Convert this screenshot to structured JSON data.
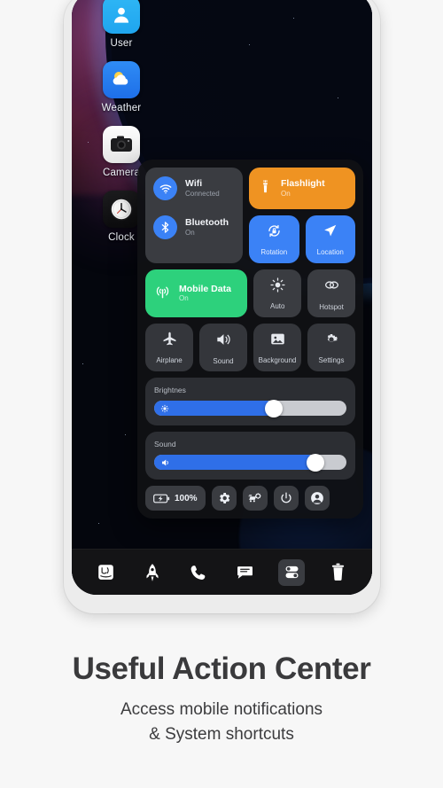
{
  "caption": {
    "headline": "Useful Action Center",
    "subtitle_line1": "Access mobile notifications",
    "subtitle_line2": "& System shortcuts"
  },
  "home_screen": {
    "apps": [
      {
        "label": "User",
        "icon": "user-icon"
      },
      {
        "label": "Weather",
        "icon": "weather-icon"
      },
      {
        "label": "Camera",
        "icon": "camera-icon"
      },
      {
        "label": "Clock",
        "icon": "clock-icon"
      }
    ]
  },
  "control_center": {
    "connectivity": [
      {
        "label": "Wifi",
        "status": "Connected",
        "icon": "wifi-icon",
        "active": true
      },
      {
        "label": "Bluetooth",
        "status": "On",
        "icon": "bluetooth-icon",
        "active": true
      }
    ],
    "flashlight": {
      "label": "Flashlight",
      "status": "On",
      "icon": "flashlight-icon",
      "color": "#ef9322"
    },
    "mobile_data": {
      "label": "Mobile Data",
      "status": "On",
      "icon": "mobile-data-icon",
      "color": "#2dd17c"
    },
    "tiles": [
      {
        "label": "Rotation",
        "icon": "rotation-lock-icon",
        "active": true,
        "color": "#3b82f6"
      },
      {
        "label": "Location",
        "icon": "location-arrow-icon",
        "active": true,
        "color": "#3b82f6"
      },
      {
        "label": "Auto",
        "icon": "brightness-auto-icon",
        "active": false
      },
      {
        "label": "Hotspot",
        "icon": "hotspot-icon",
        "active": false
      },
      {
        "label": "Airplane",
        "icon": "airplane-icon",
        "active": false
      },
      {
        "label": "Sound",
        "icon": "speaker-icon",
        "active": false
      },
      {
        "label": "Background",
        "icon": "image-icon",
        "active": false
      },
      {
        "label": "Settings",
        "icon": "gear-icon",
        "active": false
      }
    ],
    "sliders": [
      {
        "label": "Brightnes",
        "icon": "brightness-icon",
        "value": 62
      },
      {
        "label": "Sound",
        "icon": "volume-icon",
        "value": 84
      }
    ],
    "quick_actions": [
      {
        "label": "100%",
        "icon": "battery-charging-icon",
        "type": "battery"
      },
      {
        "label": "",
        "icon": "gear-icon",
        "type": "button"
      },
      {
        "label": "",
        "icon": "cleaner-boost-icon",
        "type": "button"
      },
      {
        "label": "",
        "icon": "power-icon",
        "type": "button"
      },
      {
        "label": "",
        "icon": "account-icon",
        "type": "button"
      }
    ]
  },
  "dock": {
    "items": [
      {
        "icon": "finder-icon",
        "active": false
      },
      {
        "icon": "rocket-launcher-icon",
        "active": false
      },
      {
        "icon": "phone-icon",
        "active": false
      },
      {
        "icon": "messages-icon",
        "active": false
      },
      {
        "icon": "control-center-icon",
        "active": true
      },
      {
        "icon": "trash-icon",
        "active": false
      }
    ]
  },
  "colors": {
    "accent_blue": "#3b82f6",
    "accent_orange": "#ef9322",
    "accent_green": "#2dd17c",
    "panel_bg": "#101114",
    "tile_bg": "#3a3c41"
  }
}
